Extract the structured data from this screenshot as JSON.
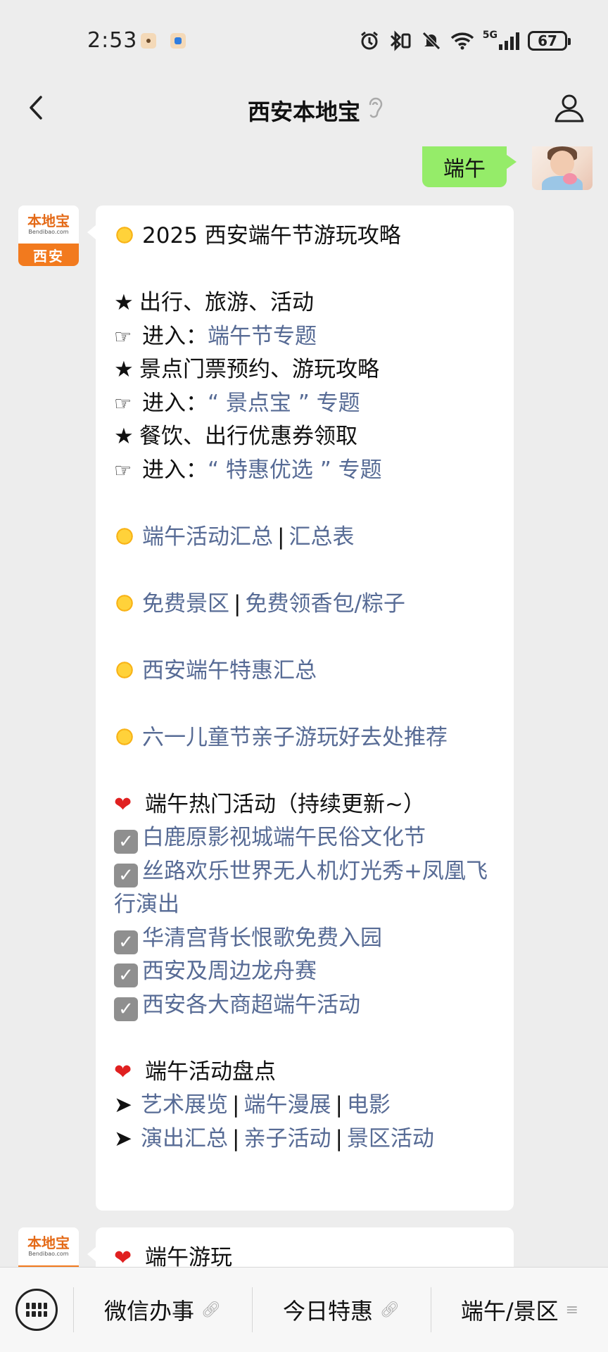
{
  "status_bar": {
    "time": "2:53",
    "network": "5G",
    "battery": "67"
  },
  "nav": {
    "title": "西安本地宝"
  },
  "me": {
    "text": "端午"
  },
  "bot": {
    "logo_text": "本地宝",
    "logo_url": "Bendibao.com",
    "city_label": "西安"
  },
  "message1": {
    "title": "2025 西安端午节游玩攻略",
    "star1": "出行、旅游、活动",
    "enter1_prefix": "进入：",
    "enter1_link": "端午节专题",
    "star2": "景点门票预约、游玩攻略",
    "enter2_prefix": "进入：",
    "enter2_link": "“ 景点宝 ” 专题",
    "star3": "餐饮、出行优惠券领取",
    "enter3_prefix": "进入：",
    "enter3_link": "“ 特惠优选 ” 专题",
    "sun1_link_a": "端午活动汇总",
    "sun1_link_b": "汇总表",
    "sun2_link_a": "免费景区",
    "sun2_link_b": "免费领香包/粽子",
    "sun3_link": "西安端午特惠汇总",
    "sun4_link": "六一儿童节亲子游玩好去处推荐",
    "hot_title": "端午热门活动（持续更新~）",
    "hot_items": [
      "白鹿原影视城端午民俗文化节",
      "丝路欢乐世界无人机灯光秀+凤凰飞行演出",
      "华清宫背长恨歌免费入园",
      "西安及周边龙舟赛",
      "西安各大商超端午活动"
    ],
    "panorama_title": "端午活动盘点",
    "row1": [
      "艺术展览",
      "端午漫展",
      "电影"
    ],
    "row2": [
      "演出汇总",
      "亲子活动",
      "景区活动"
    ]
  },
  "message2": {
    "title": "端午游玩"
  },
  "menu": {
    "items": [
      "微信办事",
      "今日特惠",
      "端午/景区"
    ]
  },
  "colors": {
    "link": "#576b95",
    "bubble_me": "#95ec69",
    "background": "#ededed",
    "brand_orange": "#f27a1e"
  }
}
